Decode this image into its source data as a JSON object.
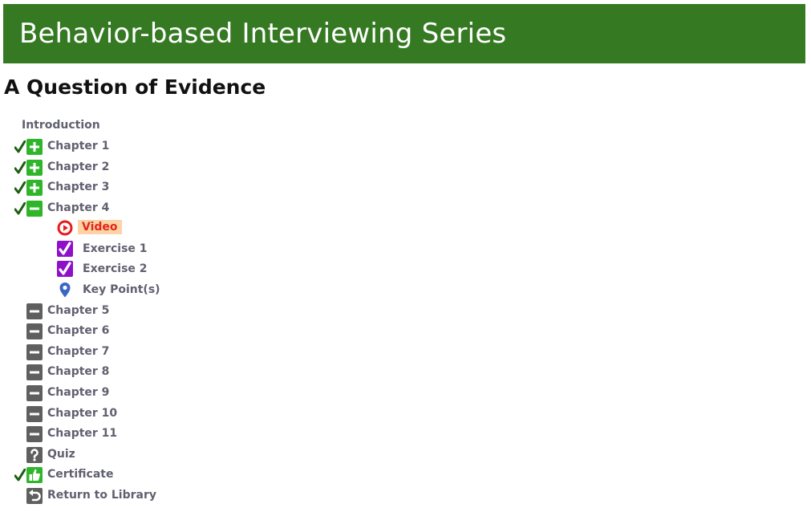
{
  "header": {
    "series_title": "Behavior-based Interviewing Series"
  },
  "course": {
    "title": "A Question of Evidence"
  },
  "toc": {
    "introduction": "Introduction",
    "chapters": [
      {
        "label": "Chapter 1",
        "completed": true,
        "state": "collapsed"
      },
      {
        "label": "Chapter 2",
        "completed": true,
        "state": "collapsed"
      },
      {
        "label": "Chapter 3",
        "completed": true,
        "state": "collapsed"
      },
      {
        "label": "Chapter 4",
        "completed": true,
        "state": "expanded"
      }
    ],
    "chapter4_items": [
      {
        "label": "Video",
        "icon": "play-icon",
        "active": true
      },
      {
        "label": "Exercise 1",
        "icon": "checkbox-icon",
        "active": false
      },
      {
        "label": "Exercise 2",
        "icon": "checkbox-icon",
        "active": false
      },
      {
        "label": "Key Point(s)",
        "icon": "map-pin-icon",
        "active": false
      }
    ],
    "locked_chapters": [
      "Chapter 5",
      "Chapter 6",
      "Chapter 7",
      "Chapter 8",
      "Chapter 9",
      "Chapter 10",
      "Chapter 11"
    ],
    "quiz": "Quiz",
    "certificate": "Certificate",
    "return": "Return to Library"
  },
  "colors": {
    "banner": "#357a22",
    "done_green": "#2fb52a",
    "check_green": "#1d5e12",
    "locked_gray": "#5f5f5f",
    "label_gray": "#606070",
    "active_text": "#e3261b",
    "active_bg": "#fbd3a6",
    "play_red": "#e81b1b",
    "exercise_purple": "#8e10c9",
    "pin_blue": "#3a66c4"
  }
}
